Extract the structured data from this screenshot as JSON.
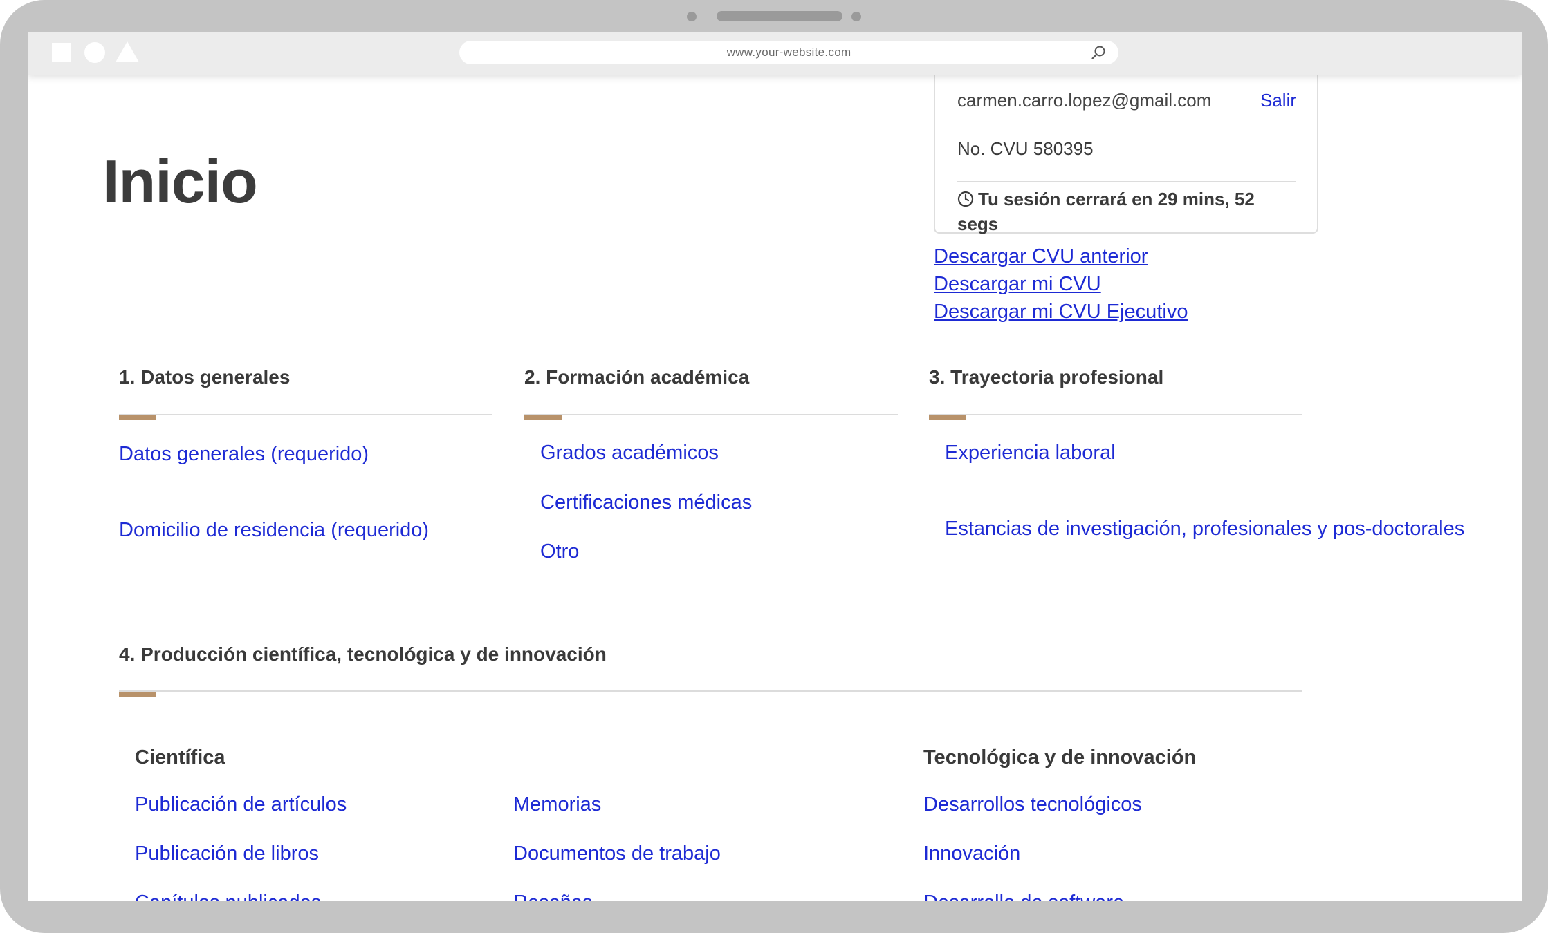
{
  "browser": {
    "url": "www.your-website.com"
  },
  "session": {
    "email": "carmen.carro.lopez@gmail.com",
    "logout_label": "Salir",
    "cvu_number": "No. CVU 580395",
    "timer_text": "Tu sesión cerrará en 29 mins, 52 segs"
  },
  "downloads": [
    {
      "label": "Descargar CVU anterior"
    },
    {
      "label": "Descargar mi CVU"
    },
    {
      "label": "Descargar mi CVU Ejecutivo"
    }
  ],
  "page": {
    "title": "Inicio"
  },
  "sections": [
    {
      "title": "1. Datos generales",
      "links": [
        "Datos generales (requerido)",
        "Domicilio de residencia (requerido)"
      ]
    },
    {
      "title": "2. Formación académica",
      "links": [
        "Grados académicos",
        "Certificaciones médicas",
        "Otro"
      ]
    },
    {
      "title": "3. Trayectoria profesional",
      "links": [
        "Experiencia laboral",
        "Estancias de investigación, profesionales y pos-doctorales"
      ]
    },
    {
      "title": "4. Producción científica, tecnológica y de innovación",
      "groups": [
        {
          "title": "Científica",
          "links_col1": [
            "Publicación de artículos",
            "Publicación de libros",
            "Capítulos publicados"
          ],
          "links_col2": [
            "Memorias",
            "Documentos de trabajo",
            "Reseñas"
          ]
        },
        {
          "title": "Tecnológica y de innovación",
          "links": [
            "Desarrollos tecnológicos",
            "Innovación",
            "Desarrollo de software"
          ]
        }
      ]
    }
  ],
  "colors": {
    "link": "#1d2ad4",
    "accent": "#b8926a",
    "heading": "#3a3a3a"
  },
  "icons": {
    "timer": "clock-icon",
    "url_search": "search-icon"
  }
}
